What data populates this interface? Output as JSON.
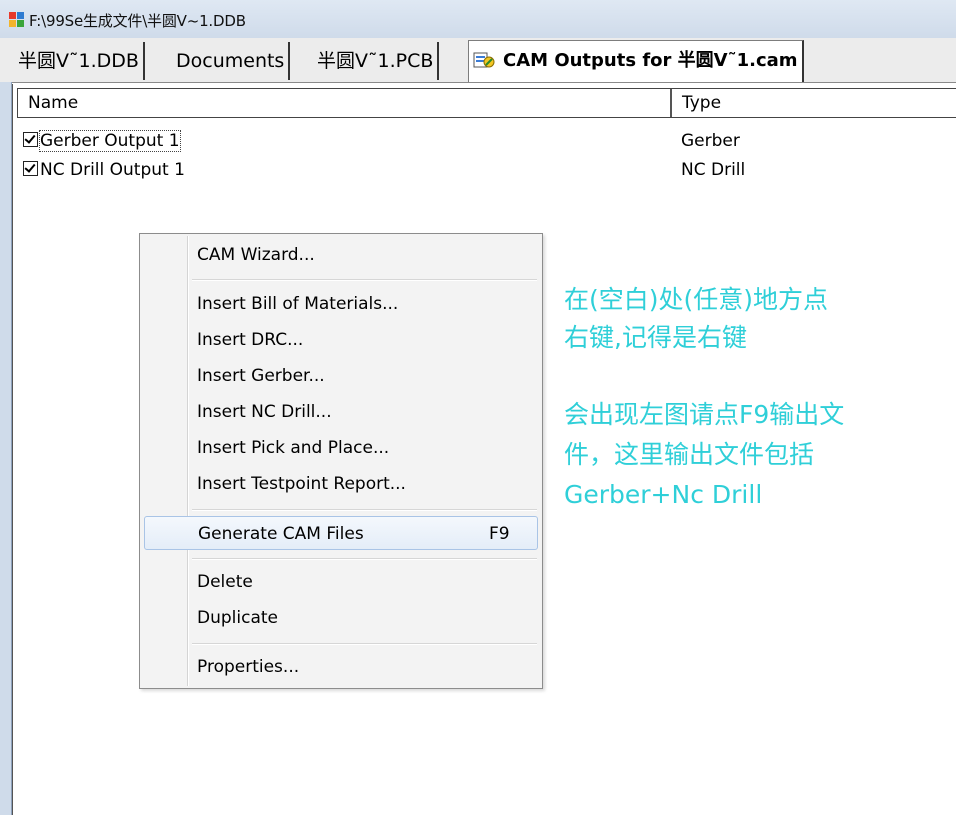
{
  "window": {
    "title": "F:\\99Se生成文件\\半圆V~1.DDB",
    "icon": "protel-app-icon"
  },
  "tabs": [
    {
      "label": "半圆V˜1.DDB",
      "active": false
    },
    {
      "label": "Documents",
      "active": false
    },
    {
      "label": "半圆V˜1.PCB",
      "active": false
    },
    {
      "label": "CAM Outputs for 半圆V˜1.cam",
      "active": true,
      "icon": "cam-document-icon"
    }
  ],
  "list": {
    "columns": [
      "Name",
      "Type"
    ],
    "rows": [
      {
        "name": "Gerber Output 1",
        "type": "Gerber",
        "checked": true,
        "focused": true
      },
      {
        "name": "NC Drill Output 1",
        "type": "NC Drill",
        "checked": true,
        "focused": false
      }
    ]
  },
  "context_menu": {
    "items": [
      {
        "label": "CAM Wizard...",
        "shortcut": ""
      },
      {
        "label": "Insert Bill of Materials...",
        "shortcut": ""
      },
      {
        "label": "Insert DRC...",
        "shortcut": ""
      },
      {
        "label": "Insert Gerber...",
        "shortcut": ""
      },
      {
        "label": "Insert NC Drill...",
        "shortcut": ""
      },
      {
        "label": "Insert Pick and Place...",
        "shortcut": ""
      },
      {
        "label": "Insert Testpoint Report...",
        "shortcut": ""
      },
      {
        "label": "Generate CAM Files",
        "shortcut": "F9",
        "highlighted": true
      },
      {
        "label": "Delete",
        "shortcut": ""
      },
      {
        "label": "Duplicate",
        "shortcut": ""
      },
      {
        "label": "Properties...",
        "shortcut": ""
      }
    ]
  },
  "annotation": {
    "line1": "在(空白)处(任意)地方点",
    "line2": "右键,记得是右键",
    "line3": "会出现左图请点F9输出文",
    "line4": "件，这里输出文件包括",
    "line5": "Gerber+Nc Drill",
    "color": "#2fcfd8"
  }
}
